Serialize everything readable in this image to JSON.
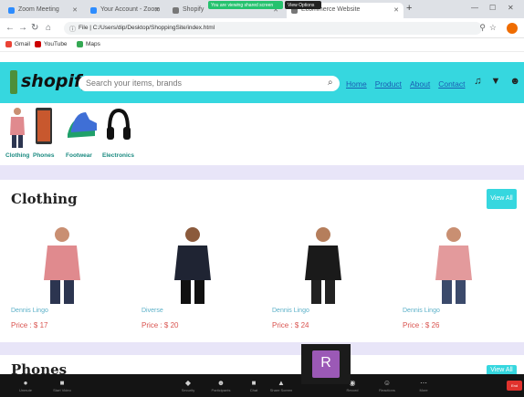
{
  "browser": {
    "tabs": [
      {
        "label": "Zoom Meeting"
      },
      {
        "label": "Your Account - Zoom"
      },
      {
        "label": "Shopify"
      },
      {
        "label": "Ecommerce Website"
      }
    ],
    "recording_banner": "You are viewing shared screen",
    "view_options_banner": "View Options",
    "url": "File | C:/Users/dip/Desktop/ShoppingSite/index.html",
    "bookmarks": [
      {
        "label": "Gmail",
        "color": "#ea4335"
      },
      {
        "label": "YouTube",
        "color": "#cc0000"
      },
      {
        "label": "Maps",
        "color": "#34a853"
      }
    ]
  },
  "site": {
    "brand": "shopify",
    "accent_color": "#36d7df",
    "search_placeholder": "Search your items, brands",
    "nav_links": [
      "Home",
      "Product",
      "About",
      "Contact"
    ],
    "nav_icons": [
      "bell-icon",
      "cart-icon",
      "user-icon"
    ],
    "categories": [
      {
        "label": "Clothing",
        "icon": "shirt-icon"
      },
      {
        "label": "Phones",
        "icon": "phone-icon"
      },
      {
        "label": "Footwear",
        "icon": "shoe-icon"
      },
      {
        "label": "Electronics",
        "icon": "headphones-icon"
      }
    ],
    "sections": [
      {
        "title": "Clothing",
        "view_all": "View All",
        "products": [
          {
            "name": "Dennis Lingo",
            "price": "Price : $ 17",
            "shirt_color": "#e08a8e"
          },
          {
            "name": "Diverse",
            "price": "Price : $ 20",
            "shirt_color": "#1f2433"
          },
          {
            "name": "Dennis Lingo",
            "price": "Price : $ 24",
            "shirt_color": "#1a1a1a"
          },
          {
            "name": "Dennis Lingo",
            "price": "Price : $ 26",
            "shirt_color": "#e39a9c"
          }
        ]
      },
      {
        "title": "Phones",
        "view_all": "View All"
      }
    ]
  },
  "zoom": {
    "participant_initial": "R",
    "toolbar": [
      "Unmute",
      "Start Video",
      "Security",
      "Participants",
      "Chat",
      "Share Screen",
      "Record",
      "Reactions",
      "More"
    ],
    "end_label": "End"
  }
}
